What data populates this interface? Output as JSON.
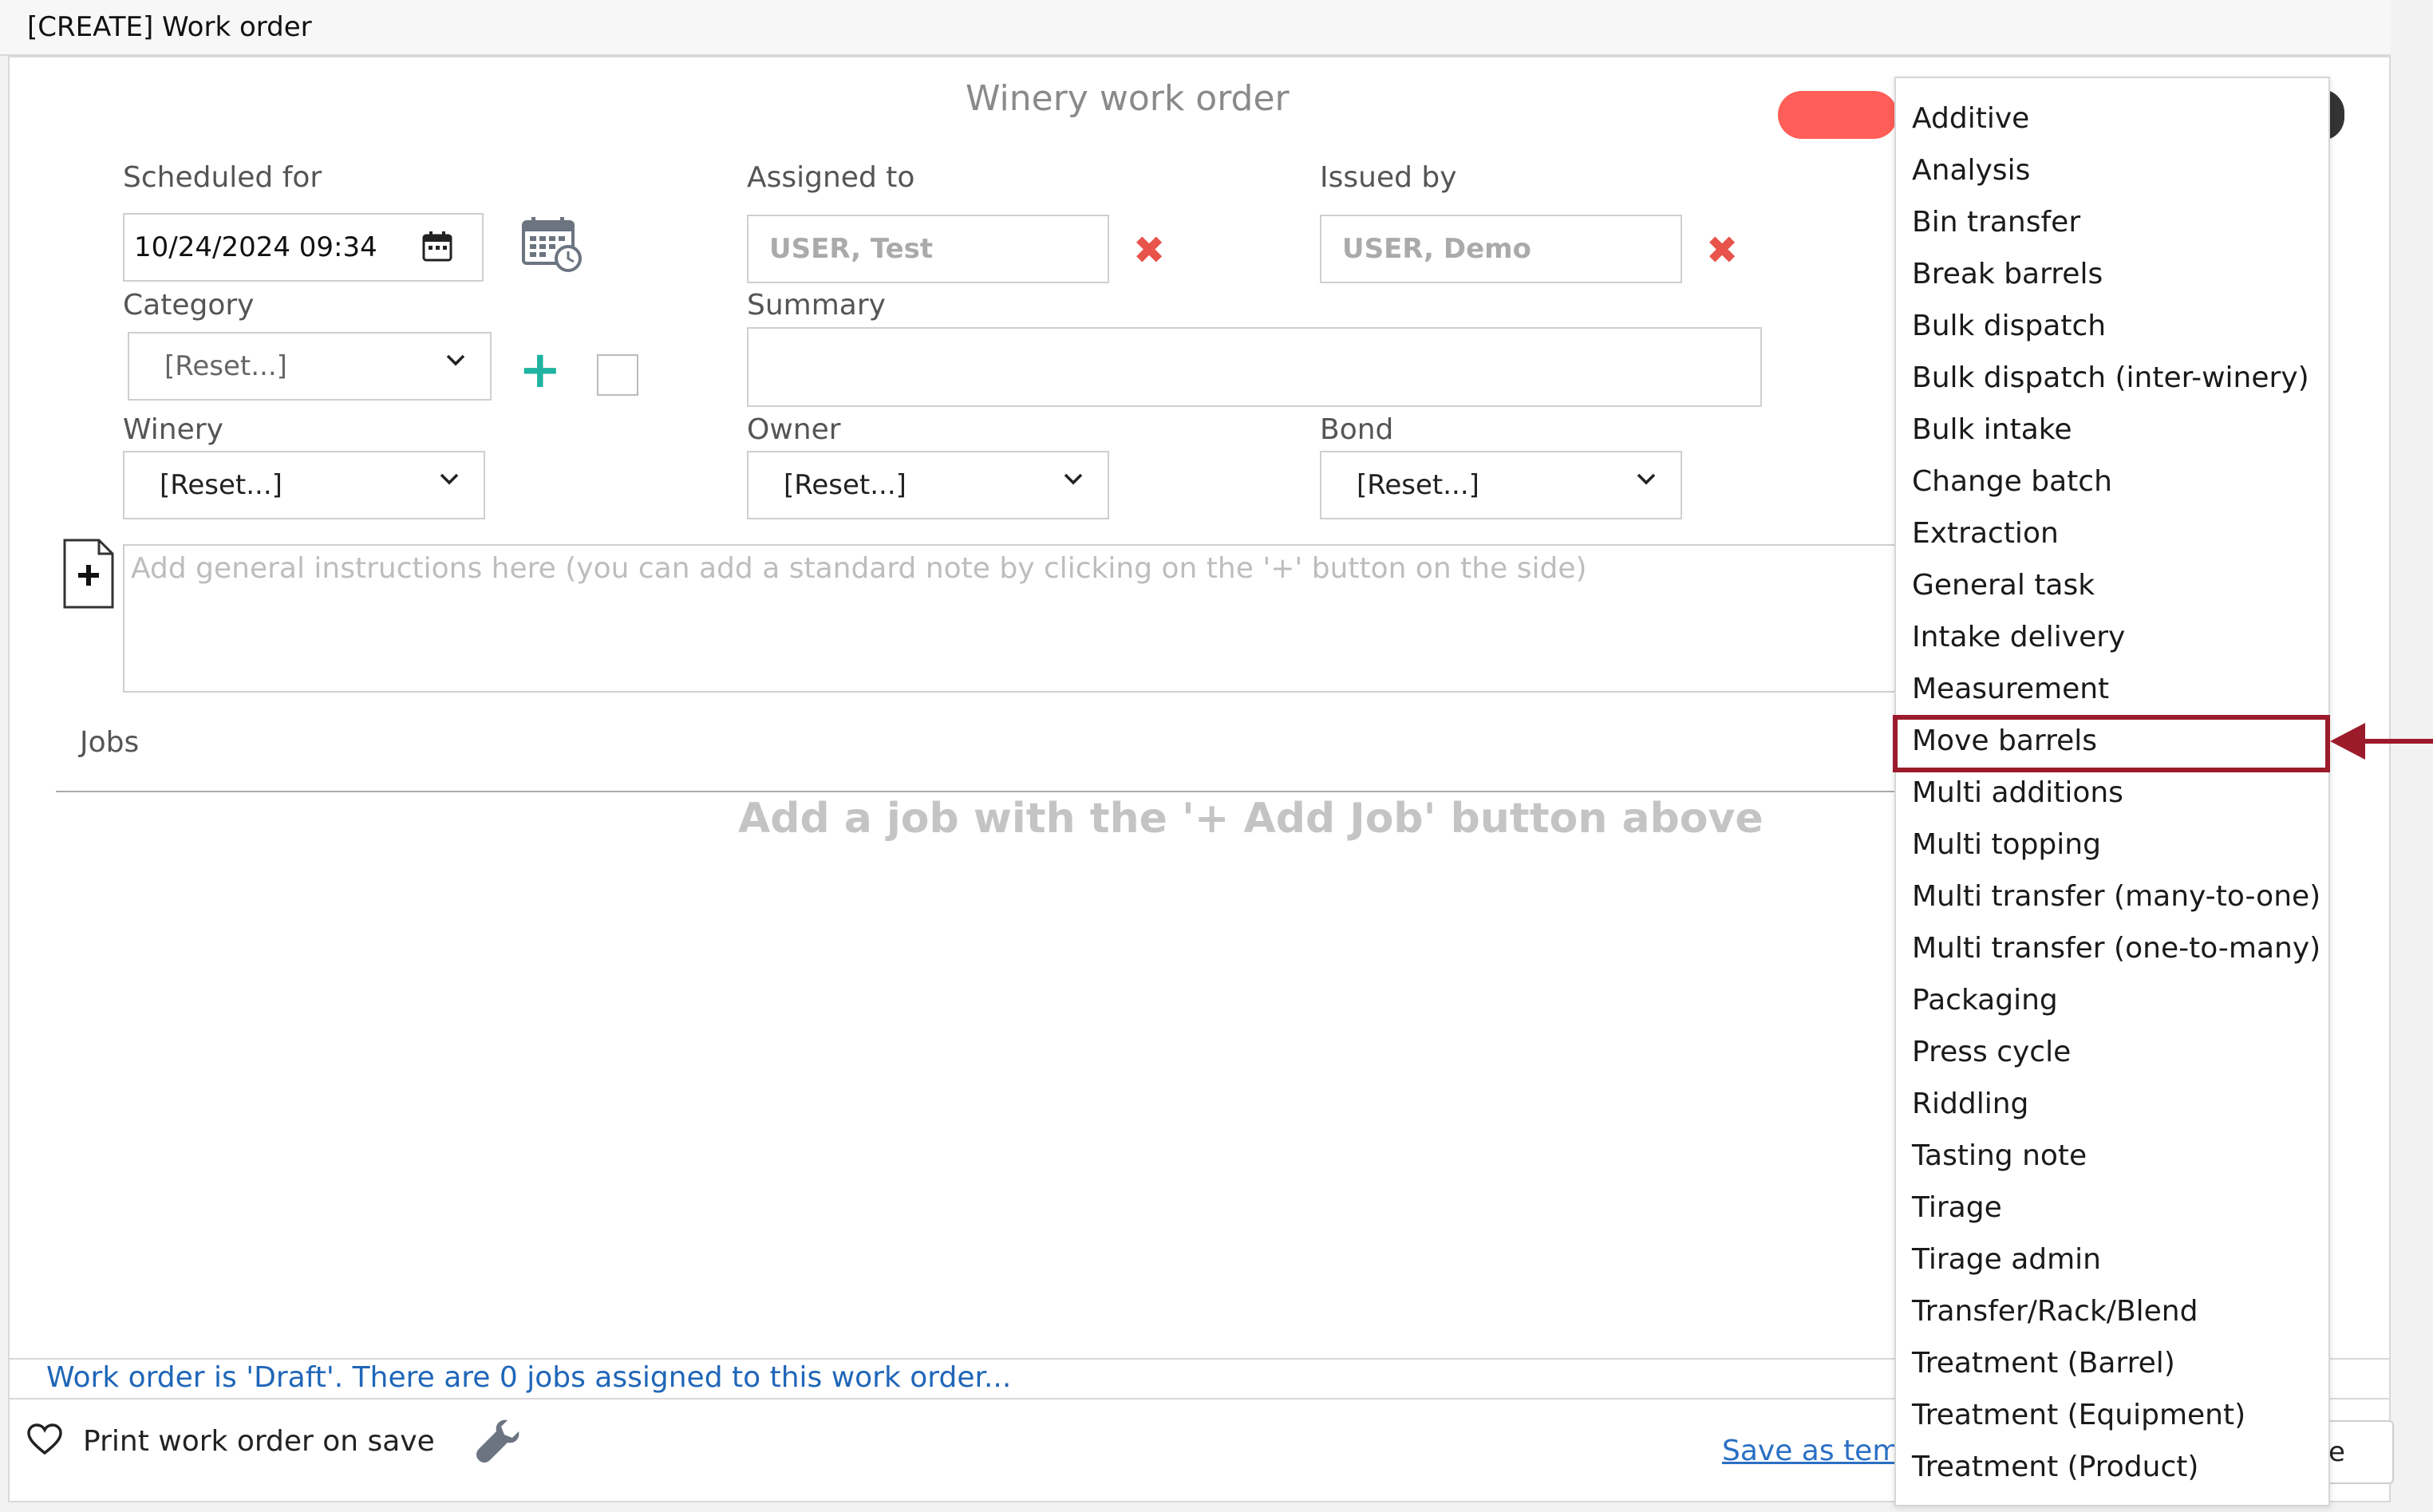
{
  "window": {
    "title": "[CREATE] Work order"
  },
  "form": {
    "title": "Winery work order",
    "scheduled_for": {
      "label": "Scheduled for",
      "value": "10/24/2024 09:34"
    },
    "assigned_to": {
      "label": "Assigned to",
      "value": "USER, Test"
    },
    "issued_by": {
      "label": "Issued by",
      "value": "USER, Demo"
    },
    "category": {
      "label": "Category",
      "value": "[Reset...]"
    },
    "summary": {
      "label": "Summary",
      "value": ""
    },
    "winery": {
      "label": "Winery",
      "value": "[Reset...]"
    },
    "owner": {
      "label": "Owner",
      "value": "[Reset...]"
    },
    "bond": {
      "label": "Bond",
      "value": "[Reset...]"
    },
    "instructions_placeholder": "Add general instructions here (you can add a standard note by clicking on the '+' button on the side)"
  },
  "jobs": {
    "label": "Jobs",
    "empty_message": "Add a job with the '+ Add Job' button above"
  },
  "status": {
    "text": "Work order is 'Draft'. There are 0 jobs assigned to this work order..."
  },
  "footer": {
    "print_label": "Print work order on save",
    "save_template_label": "Save as tem",
    "save_button_label": "e"
  },
  "menu": {
    "highlighted": "Move barrels",
    "highlight_color": "#9b1b2a",
    "items": [
      "Additive",
      "Analysis",
      "Bin transfer",
      "Break barrels",
      "Bulk dispatch",
      "Bulk dispatch (inter-winery)",
      "Bulk intake",
      "Change batch",
      "Extraction",
      "General task",
      "Intake delivery",
      "Measurement",
      "Move barrels",
      "Multi additions",
      "Multi topping",
      "Multi transfer (many-to-one)",
      "Multi transfer (one-to-many)",
      "Packaging",
      "Press cycle",
      "Riddling",
      "Tasting note",
      "Tirage",
      "Tirage admin",
      "Transfer/Rack/Blend",
      "Treatment (Barrel)",
      "Treatment (Equipment)",
      "Treatment (Product)"
    ]
  },
  "colors": {
    "accent_red": "#ff5d57",
    "remove_red": "#e8534a",
    "add_green": "#1fb3a0",
    "link_blue": "#1f66b8"
  }
}
